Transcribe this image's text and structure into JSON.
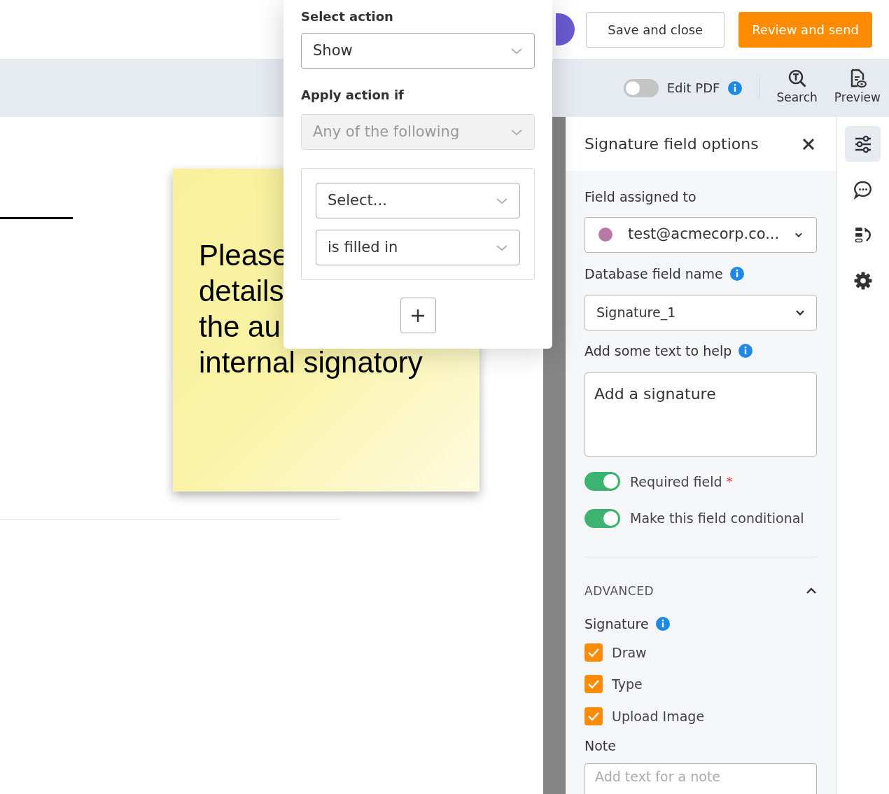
{
  "header": {
    "buttons": [
      {
        "label": "Save and close",
        "kind": "secondary"
      },
      {
        "label": "Review and send",
        "kind": "primary"
      }
    ]
  },
  "toolbar": {
    "edit_pdf": {
      "label": "Edit PDF",
      "on": false
    },
    "tools": [
      {
        "label": "Search",
        "kind": "search"
      },
      {
        "label": "Preview",
        "kind": "preview"
      }
    ]
  },
  "document": {
    "note_lines": [
      "Please",
      "details",
      "the au",
      "internal signatory"
    ]
  },
  "condition_popup": {
    "action_label": "Select action",
    "action": "Show",
    "apply_label": "Apply action if",
    "apply_value": "Any of the following",
    "apply_disabled": true,
    "rules": [
      {
        "field": "Select...",
        "condition": "is filled in"
      }
    ]
  },
  "panel": {
    "title": "Signature field options",
    "assigned_label": "Field assigned to",
    "assigned_value": "test@acmecorp.co...",
    "db_label": "Database field name",
    "db_value": "Signature_1",
    "help_label": "Add some text to help",
    "help_value": "Add a signature",
    "toggles": [
      {
        "label": "Required field",
        "required_mark": "*",
        "on": true
      },
      {
        "label": "Make this field conditional",
        "on": true
      }
    ],
    "advanced": {
      "label": "ADVANCED",
      "expanded": true,
      "signature_label": "Signature",
      "options": [
        {
          "label": "Draw",
          "checked": true
        },
        {
          "label": "Type",
          "checked": true
        },
        {
          "label": "Upload Image",
          "checked": true
        }
      ],
      "note_label": "Note",
      "note_placeholder": "Add text for a note"
    }
  },
  "rail": [
    {
      "kind": "sliders",
      "selected": true
    },
    {
      "kind": "comment",
      "selected": false
    },
    {
      "kind": "reorder",
      "selected": false
    },
    {
      "kind": "settings",
      "selected": false
    }
  ]
}
